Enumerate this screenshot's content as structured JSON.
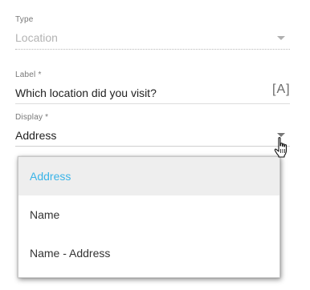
{
  "form": {
    "type": {
      "label": "Type",
      "value": "Location"
    },
    "label": {
      "label": "Label *",
      "value": "Which location did you visit?",
      "translate_button": "[A]"
    },
    "display": {
      "label": "Display *",
      "value": "Address"
    }
  },
  "dropdown": {
    "options": [
      {
        "label": "Address",
        "selected": true
      },
      {
        "label": "Name",
        "selected": false
      },
      {
        "label": "Name - Address",
        "selected": false
      }
    ]
  },
  "colors": {
    "accent": "#3ab4e8",
    "selected_bg": "#eeeeee",
    "disabled_text": "#b3b3b3"
  },
  "icons": {
    "type_caret": "chevron-down-icon",
    "display_caret": "chevron-down-icon",
    "cursor": "hand-pointer-icon"
  }
}
